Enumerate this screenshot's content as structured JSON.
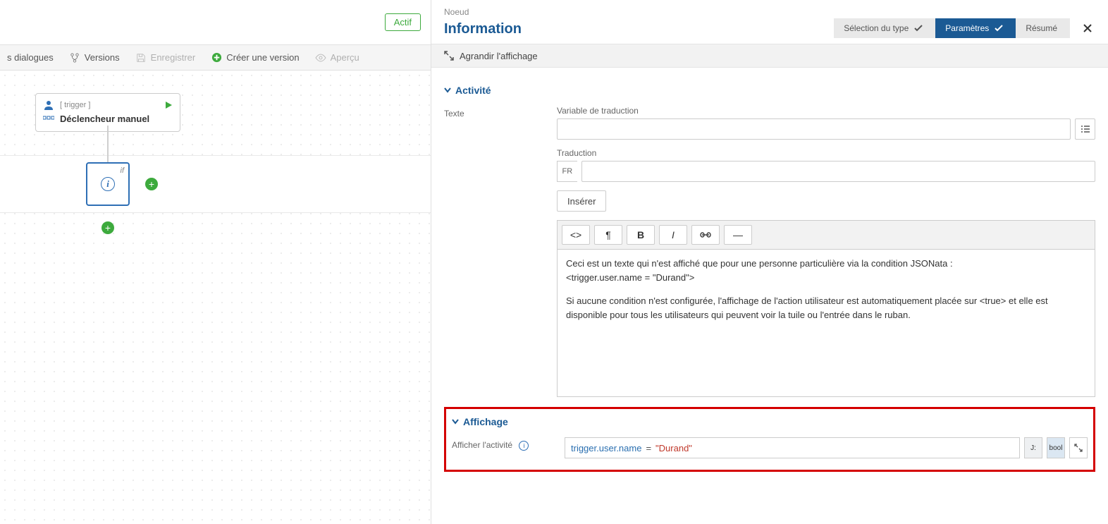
{
  "left": {
    "status_badge": "Actif",
    "toolbar": {
      "dialogues": "s dialogues",
      "versions": "Versions",
      "save": "Enregistrer",
      "create_version": "Créer une version",
      "preview": "Aperçu"
    },
    "trigger": {
      "meta": "[ trigger ]",
      "title": "Déclencheur manuel"
    },
    "if_label": "if"
  },
  "right": {
    "crumb": "Noeud",
    "title": "Information",
    "steps": {
      "s1": "Sélection du type",
      "s2": "Paramètres",
      "s3": "Résumé"
    },
    "expand": "Agrandir l'affichage",
    "section_activity": "Activité",
    "label_texte": "Texte",
    "label_var_trad": "Variable de traduction",
    "label_trad": "Traduction",
    "lang_prefix": "FR",
    "btn_insert": "Insérer",
    "editor_line1": "Ceci est un texte qui n'est affiché que pour une personne particulière via la condition JSONata :",
    "editor_line2": "<trigger.user.name = \"Durand\">",
    "editor_line3": "Si aucune condition n'est configurée, l'affichage de l'action utilisateur est automatiquement placée sur <true> et elle est disponible pour tous les utilisateurs qui peuvent voir la tuile ou l'entrée dans le ruban.",
    "section_affichage": "Affichage",
    "label_afficher": "Afficher l'activité",
    "code": {
      "path": "trigger.user.name",
      "op": "=",
      "str": "\"Durand\""
    },
    "mini": {
      "j": "J:",
      "bool": "bool"
    }
  }
}
